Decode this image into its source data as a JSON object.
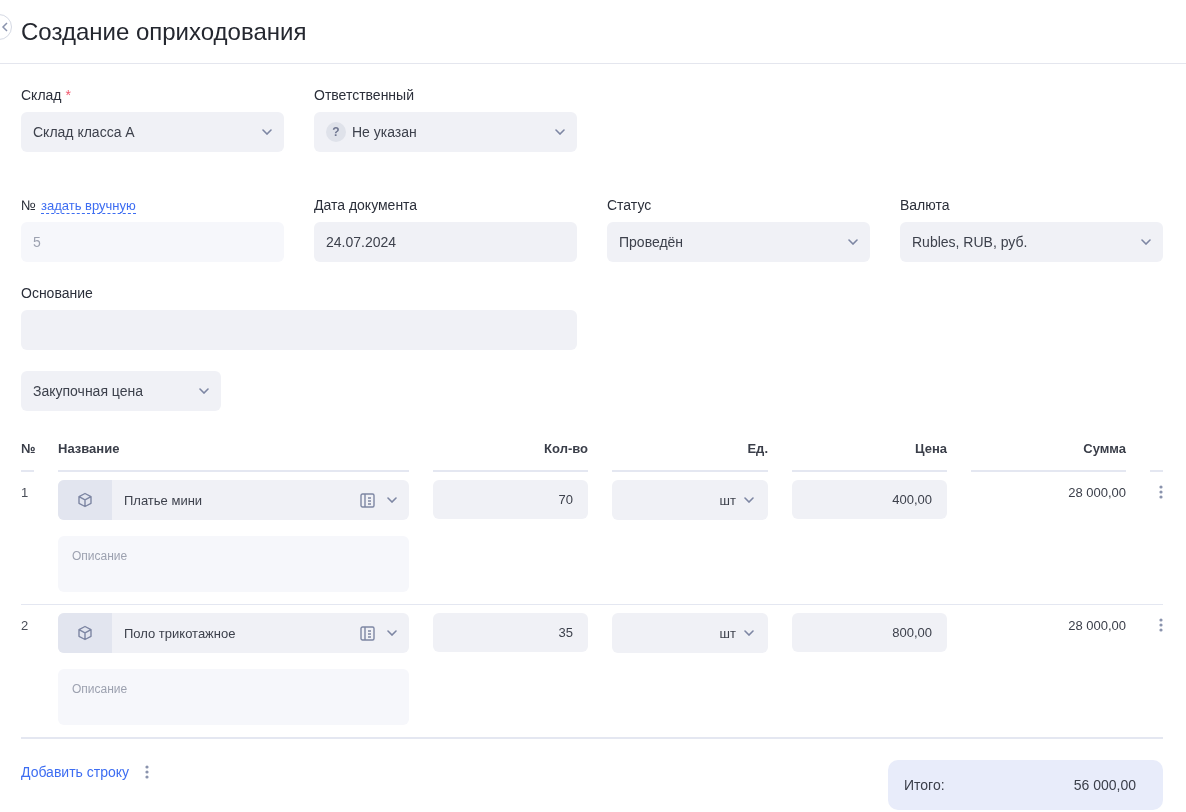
{
  "header": {
    "title": "Создание оприходования"
  },
  "fields": [
    {
      "kind": "select",
      "label": "Склад",
      "required_mark": "*",
      "value": "Склад класса А"
    },
    {
      "kind": "person",
      "label": "Ответственный",
      "value": "Не указан",
      "icon_text": "?"
    },
    {
      "kind": "break"
    },
    {
      "kind": "number",
      "label": "№",
      "link": "задать вручную",
      "placeholder": "5"
    },
    {
      "kind": "input",
      "label": "Дата документа",
      "value": "24.07.2024"
    },
    {
      "kind": "select",
      "label": "Статус",
      "value": "Проведён"
    },
    {
      "kind": "select",
      "label": "Валюта",
      "value": "Rubles, RUB, руб."
    },
    {
      "kind": "input",
      "label": "Основание",
      "wide": true
    }
  ],
  "price_type": {
    "value": "Закупочная цена"
  },
  "table": {
    "columns": [
      "№",
      "Название",
      "Кол-во",
      "Ед.",
      "Цена",
      "Сумма"
    ],
    "rows": [
      {
        "number": "1",
        "name": "Платье мини",
        "description_placeholder": "Описание",
        "qty": "70",
        "unit": "шт",
        "price": "400,00",
        "sum": "28 000,00"
      },
      {
        "number": "2",
        "name": "Поло трикотажное",
        "description_placeholder": "Описание",
        "qty": "35",
        "unit": "шт",
        "price": "800,00",
        "sum": "28 000,00"
      }
    ]
  },
  "footer": {
    "add_row": "Добавить строку",
    "total_label": "Итого:",
    "total_value": "56 000,00"
  }
}
